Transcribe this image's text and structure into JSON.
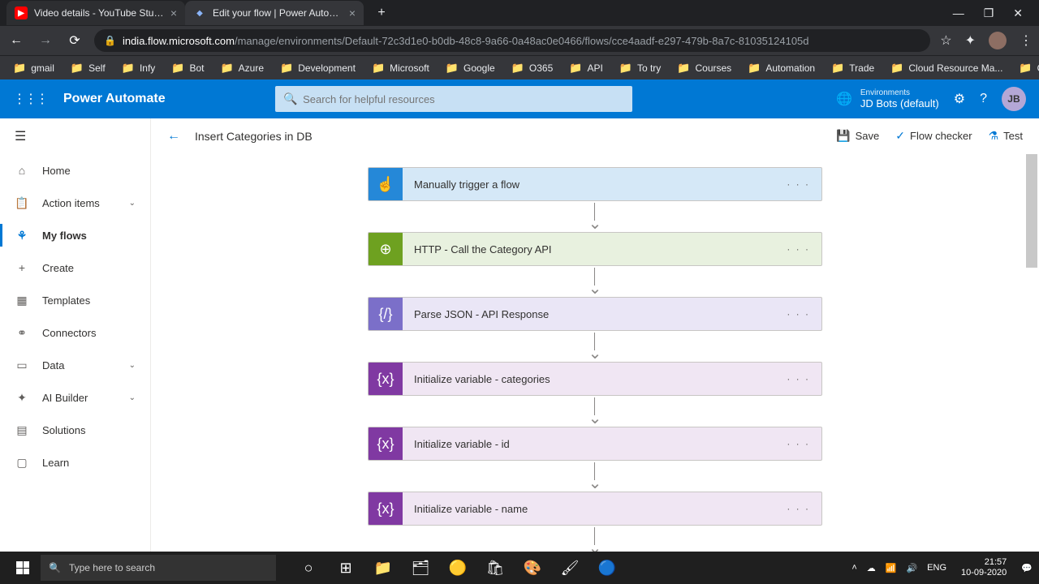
{
  "browser": {
    "tabs": [
      {
        "title": "Video details - YouTube Studio",
        "favicon": "yt",
        "active": false
      },
      {
        "title": "Edit your flow | Power Automate",
        "favicon": "pa",
        "active": true
      }
    ],
    "url_host": "india.flow.microsoft.com",
    "url_path": "/manage/environments/Default-72c3d1e0-b0db-48c8-9a66-0a48ac0e0466/flows/cce4aadf-e297-479b-8a7c-81035124105d",
    "bookmarks": [
      "gmail",
      "Self",
      "Infy",
      "Bot",
      "Azure",
      "Development",
      "Microsoft",
      "Google",
      "O365",
      "API",
      "To try",
      "Courses",
      "Automation",
      "Trade",
      "Cloud Resource Ma...",
      "OpenHack"
    ]
  },
  "pa": {
    "brand": "Power Automate",
    "search_placeholder": "Search for helpful resources",
    "env_label": "Environments",
    "env_value": "JD Bots (default)",
    "avatar": "JB"
  },
  "sidebar": {
    "items": [
      {
        "label": "Home",
        "icon": "⌂"
      },
      {
        "label": "Action items",
        "icon": "📋",
        "chev": true
      },
      {
        "label": "My flows",
        "icon": "⚘",
        "active": true
      },
      {
        "label": "Create",
        "icon": "+"
      },
      {
        "label": "Templates",
        "icon": "▦"
      },
      {
        "label": "Connectors",
        "icon": "⚭"
      },
      {
        "label": "Data",
        "icon": "▭",
        "chev": true
      },
      {
        "label": "AI Builder",
        "icon": "✦",
        "chev": true
      },
      {
        "label": "Solutions",
        "icon": "▤"
      },
      {
        "label": "Learn",
        "icon": "▢"
      }
    ]
  },
  "toolbar": {
    "flow_name": "Insert Categories in DB",
    "save": "Save",
    "checker": "Flow checker",
    "test": "Test"
  },
  "steps": [
    {
      "label": "Manually trigger a flow",
      "cls": "c-trigger",
      "icon": "☝"
    },
    {
      "label": "HTTP - Call the Category API",
      "cls": "c-http",
      "icon": "⊕"
    },
    {
      "label": "Parse JSON - API Response",
      "cls": "c-parse",
      "icon": "{/}"
    },
    {
      "label": "Initialize variable - categories",
      "cls": "c-var",
      "icon": "{x}"
    },
    {
      "label": "Initialize variable - id",
      "cls": "c-var",
      "icon": "{x}"
    },
    {
      "label": "Initialize variable - name",
      "cls": "c-var",
      "icon": "{x}"
    }
  ],
  "taskbar": {
    "search_placeholder": "Type here to search",
    "lang": "ENG",
    "time": "21:57",
    "date": "10-09-2020"
  }
}
